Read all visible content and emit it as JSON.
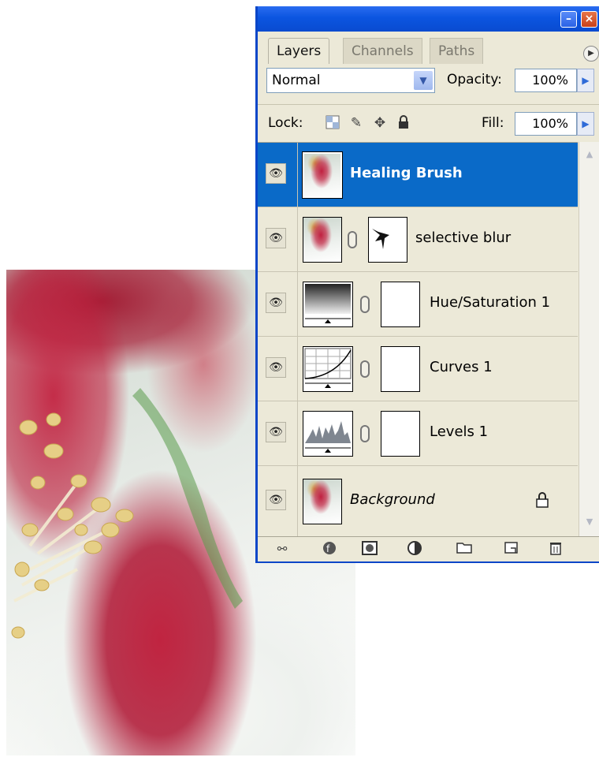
{
  "panel": {
    "tabs": [
      {
        "label": "Layers"
      },
      {
        "label": "Channels"
      },
      {
        "label": "Paths"
      }
    ],
    "blend_mode": "Normal",
    "opacity_label": "Opacity:",
    "opacity_value": "100%",
    "lock_label": "Lock:",
    "fill_label": "Fill:",
    "fill_value": "100%",
    "layers": [
      {
        "name": "Healing Brush",
        "selected": true,
        "visible": true
      },
      {
        "name": "selective blur",
        "visible": true,
        "has_mask": true
      },
      {
        "name": "Hue/Saturation 1",
        "visible": true,
        "adjustment": "hue-saturation"
      },
      {
        "name": "Curves 1",
        "visible": true,
        "adjustment": "curves"
      },
      {
        "name": "Levels 1",
        "visible": true,
        "adjustment": "levels"
      },
      {
        "name": "Background",
        "visible": true,
        "locked": true
      }
    ]
  },
  "colors": {
    "selection": "#0a6ac8",
    "titlebar": "#0b55e0",
    "panel_bg": "#ece9d8"
  },
  "icons": {
    "visibility": "eye-icon",
    "layer_lock": "lock-icon",
    "link": "chain-link-icon"
  }
}
